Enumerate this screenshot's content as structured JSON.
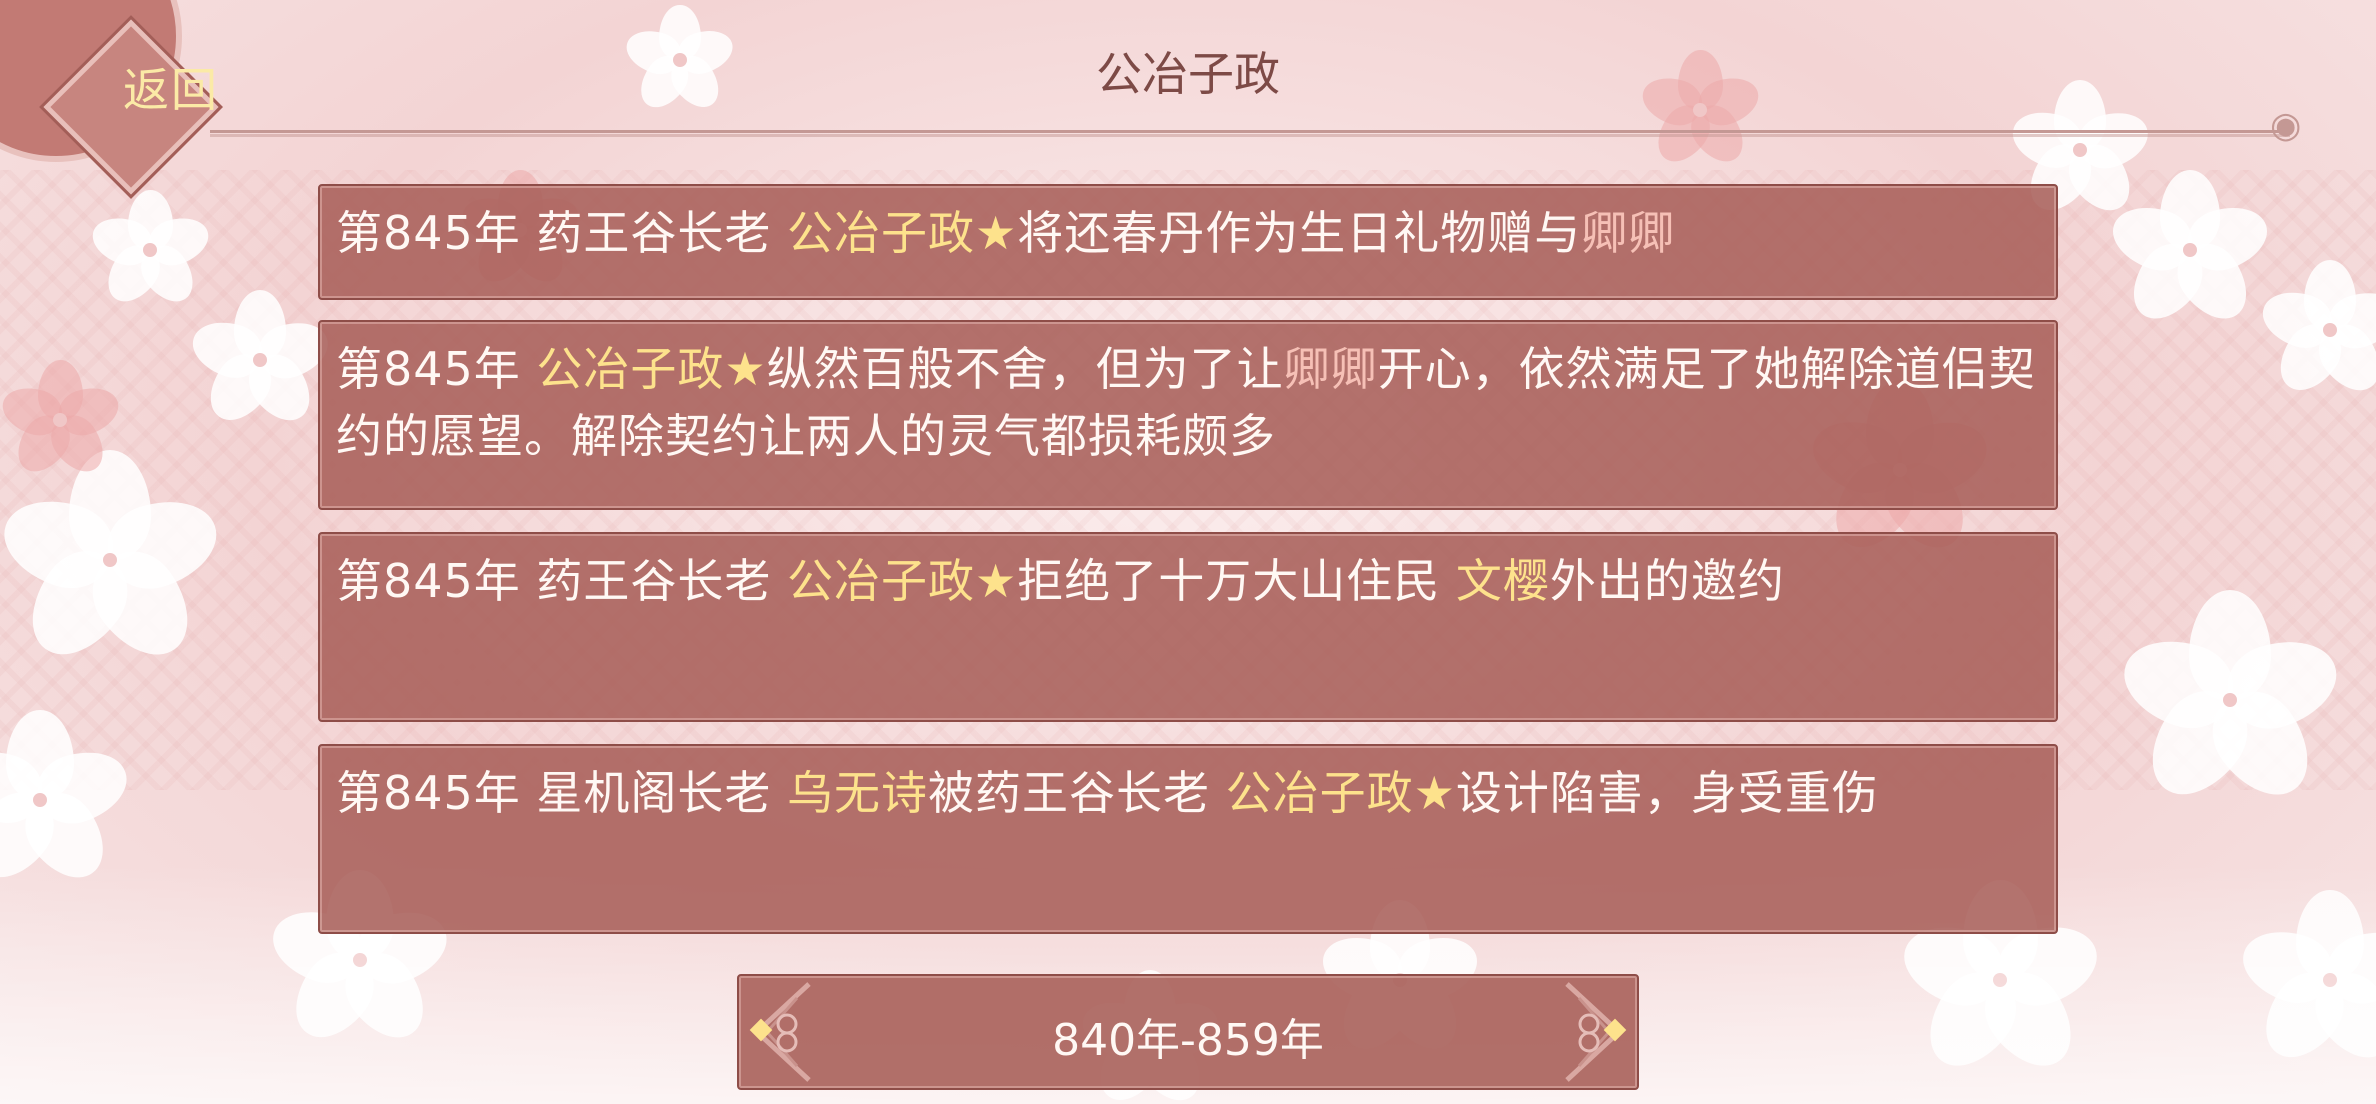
{
  "header": {
    "back_label": "返回",
    "title": "公冶子政"
  },
  "events": [
    {
      "segments": [
        {
          "text": "第845年 药王谷长老 ",
          "style": "plain"
        },
        {
          "text": "公冶子政★",
          "style": "gold"
        },
        {
          "text": "将还春丹作为生日礼物赠与",
          "style": "plain"
        },
        {
          "text": "卿卿",
          "style": "pink"
        }
      ]
    },
    {
      "segments": [
        {
          "text": "第845年 ",
          "style": "plain"
        },
        {
          "text": "公冶子政★",
          "style": "gold"
        },
        {
          "text": "纵然百般不舍，但为了让",
          "style": "plain"
        },
        {
          "text": "卿卿",
          "style": "pink"
        },
        {
          "text": "开心，依然满足了她解除道侣契约的愿望。解除契约让两人的灵气都损耗颇多",
          "style": "plain"
        }
      ]
    },
    {
      "segments": [
        {
          "text": "第845年 药王谷长老 ",
          "style": "plain"
        },
        {
          "text": "公冶子政★",
          "style": "gold"
        },
        {
          "text": "拒绝了十万大山住民 ",
          "style": "plain"
        },
        {
          "text": "文樱",
          "style": "gold"
        },
        {
          "text": "外出的邀约",
          "style": "plain"
        }
      ]
    },
    {
      "segments": [
        {
          "text": "第845年 星机阁长老 ",
          "style": "plain"
        },
        {
          "text": "乌无诗",
          "style": "gold"
        },
        {
          "text": "被药王谷长老 ",
          "style": "plain"
        },
        {
          "text": "公冶子政★",
          "style": "gold"
        },
        {
          "text": "设计陷害，身受重伤",
          "style": "plain"
        }
      ]
    }
  ],
  "period_selector": {
    "label": "840年-859年",
    "prev_icon": "ornate-left-arrow-icon",
    "next_icon": "ornate-right-arrow-icon"
  },
  "colors": {
    "card_bg": "#a8605a",
    "highlight_gold": "#fde28c",
    "highlight_pink": "#f6c0b6",
    "title_text": "#7d4a46",
    "back_label": "#fbeaa6"
  }
}
